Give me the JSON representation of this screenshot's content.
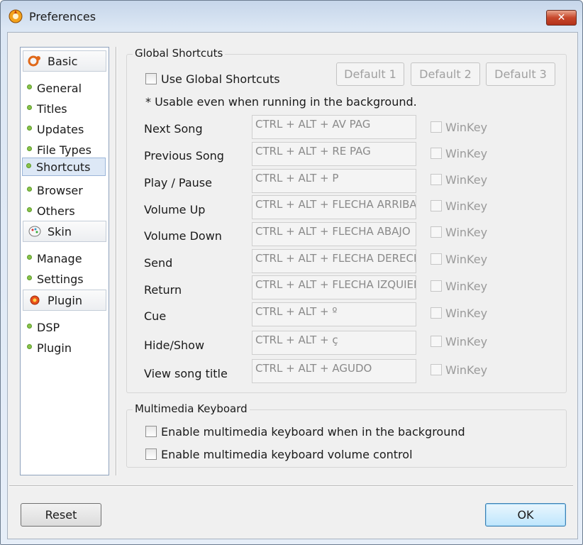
{
  "window": {
    "title": "Preferences",
    "close_label": "✕"
  },
  "nav": {
    "sections": [
      {
        "label": "Basic",
        "icon": "basic-gear-icon"
      },
      {
        "label": "Skin",
        "icon": "skin-icon"
      },
      {
        "label": "Plugin",
        "icon": "plugin-icon"
      }
    ],
    "items": [
      "General",
      "Titles",
      "Updates",
      "File Types",
      "Shortcuts",
      "Browser",
      "Others",
      "Manage",
      "Settings",
      "DSP",
      "Plugin"
    ],
    "selected": "Shortcuts"
  },
  "global": {
    "legend": "Global Shortcuts",
    "use_label": "Use Global Shortcuts",
    "use_checked": false,
    "default_buttons": [
      "Default 1",
      "Default 2",
      "Default 3"
    ],
    "note": "* Usable even when running in the background.",
    "winkey_label": "WinKey",
    "shortcuts": [
      {
        "action": "Next Song",
        "keys": "CTRL + ALT + AV PAG"
      },
      {
        "action": "Previous Song",
        "keys": "CTRL + ALT + RE PAG"
      },
      {
        "action": "Play / Pause",
        "keys": "CTRL + ALT + P"
      },
      {
        "action": "Volume Up",
        "keys": "CTRL + ALT + FLECHA ARRIBA"
      },
      {
        "action": "Volume Down",
        "keys": "CTRL + ALT + FLECHA ABAJO"
      },
      {
        "action": "Send",
        "keys": "CTRL + ALT + FLECHA DERECHA"
      },
      {
        "action": "Return",
        "keys": "CTRL + ALT + FLECHA IZQUIERDA"
      },
      {
        "action": "Cue",
        "keys": "CTRL + ALT + º"
      },
      {
        "action": "Hide/Show",
        "keys": "CTRL + ALT + ç"
      },
      {
        "action": "View song title",
        "keys": "CTRL + ALT + AGUDO"
      }
    ]
  },
  "multimedia": {
    "legend": "Multimedia Keyboard",
    "options": [
      {
        "label": "Enable multimedia keyboard when in the background",
        "checked": false
      },
      {
        "label": "Enable multimedia keyboard volume control",
        "checked": false
      }
    ]
  },
  "footer": {
    "reset_label": "Reset",
    "ok_label": "OK"
  }
}
